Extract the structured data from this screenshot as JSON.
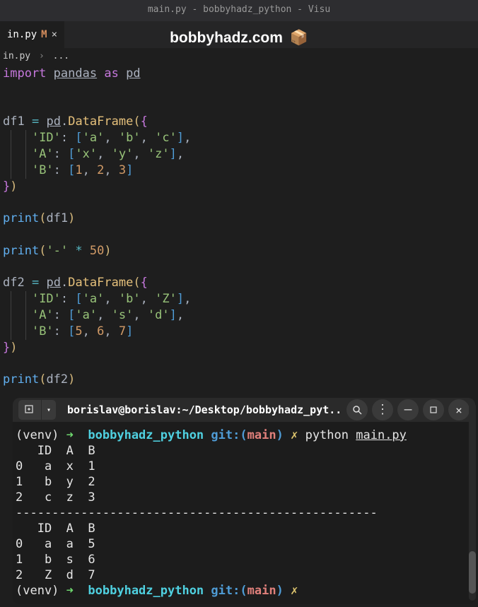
{
  "window": {
    "title": "main.py - bobbyhadz_python - Visu"
  },
  "tab": {
    "name": "in.py",
    "modified": "M",
    "close": "×"
  },
  "watermark": {
    "text": "bobbyhadz.com",
    "icon": "📦"
  },
  "breadcrumb": {
    "file": "in.py",
    "sep": "›",
    "dots": "..."
  },
  "code": {
    "import": "import",
    "pandas": "pandas",
    "as": "as",
    "pd_alias": "pd",
    "df1": "df1",
    "eq": "=",
    "pd": "pd",
    "dot": ".",
    "DataFrame": "DataFrame",
    "ID": "'ID'",
    "A": "'A'",
    "B": "'B'",
    "a": "'a'",
    "b": "'b'",
    "c": "'c'",
    "x": "'x'",
    "y": "'y'",
    "z": "'z'",
    "Z": "'Z'",
    "s": "'s'",
    "d": "'d'",
    "n1": "1",
    "n2": "2",
    "n3": "3",
    "n5": "5",
    "n6": "6",
    "n7": "7",
    "n50": "50",
    "df2": "df2",
    "print": "print",
    "dash": "'-'",
    "star": "*",
    "colon": ":",
    "comma": ","
  },
  "terminal": {
    "title": "borislav@borislav:~/Desktop/bobbyhadz_pyt...",
    "prompt": {
      "venv": "(venv)",
      "arrow": "➜",
      "dir": "bobbyhadz_python",
      "git": "git:",
      "branch": "main",
      "x": "✗",
      "cmd": "python",
      "file": "main.py"
    },
    "output": [
      "   ID  A  B",
      "0   a  x  1",
      "1   b  y  2",
      "2   c  z  3",
      "--------------------------------------------------",
      "   ID  A  B",
      "0   a  a  5",
      "1   b  s  6",
      "2   Z  d  7"
    ]
  }
}
